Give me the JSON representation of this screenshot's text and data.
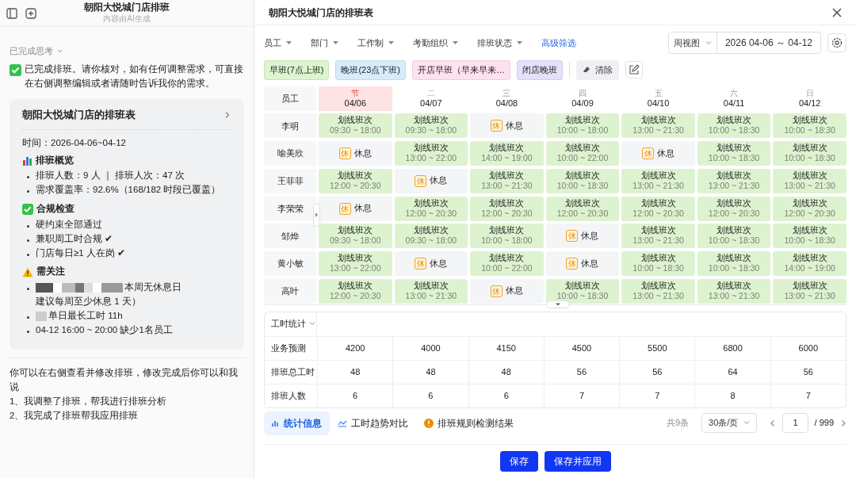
{
  "chat": {
    "title": "朝阳大悦城门店排班",
    "subtitle": "内容由AI生成",
    "thinking": "已完成思考",
    "message": "已完成排班。请你核对，如有任何调整需求，可直接在右侧调整编辑或者请随时告诉我你的需求。",
    "card": {
      "title": "朝阳大悦城门店的排班表",
      "time": "时间：2026-04-06~04-12",
      "sections": [
        {
          "kind": "chart",
          "title": "排班概览",
          "items": [
            {
              "text": "排班人数：9 人 ｜ 排班人次：47 次",
              "redacted": false
            },
            {
              "text": "需求覆盖率：92.6%（168/182 时段已覆盖）",
              "redacted": false
            }
          ]
        },
        {
          "kind": "check",
          "title": "合规检查",
          "items": [
            {
              "text": "硬约束全部通过",
              "redacted": false
            },
            {
              "text": "兼职周工时合规 ✔",
              "redacted": false
            },
            {
              "text": "门店每日≥1 人在岗 ✔",
              "redacted": false
            }
          ]
        },
        {
          "kind": "warning",
          "title": "需关注",
          "items": [
            {
              "text": "本周无休息日",
              "note": "建议每周至少休息 1 天）",
              "redacted": true
            },
            {
              "text": "单日最长工时 11h",
              "redacted": true
            },
            {
              "text": "04-12 16:00 ~ 20:00 缺少1名员工",
              "redacted": false
            }
          ]
        }
      ]
    },
    "footer": [
      "你可以在右侧查看并修改排班，修改完成后你可以和我说",
      "1、我调整了排班，帮我进行排班分析",
      "2、我完成了排班帮我应用排班"
    ]
  },
  "panel": {
    "title": "朝阳大悦城门店的排班表",
    "filters": [
      "员工",
      "部门",
      "工作制",
      "考勤组织",
      "排班状态"
    ],
    "advanced_filter": "高级筛选",
    "view": "周视图",
    "date_range": "2026 04-06 ～ 04-12",
    "tags": [
      {
        "label": "早班(7点上班)",
        "color": "#dcf5cf"
      },
      {
        "label": "晚班(23点下班)",
        "color": "#d6ecfb"
      },
      {
        "label": "开店早班（早来早来…",
        "color": "#fde1f0"
      },
      {
        "label": "闭店晚班",
        "color": "#e4e0fb"
      }
    ],
    "clear_button": "清除",
    "schedule": {
      "corner": "员工",
      "days": [
        {
          "weekday": "节",
          "date": "04/06",
          "holiday": true
        },
        {
          "weekday": "二",
          "date": "04/07",
          "holiday": false
        },
        {
          "weekday": "三",
          "date": "04/08",
          "holiday": false
        },
        {
          "weekday": "四",
          "date": "04/09",
          "holiday": false
        },
        {
          "weekday": "五",
          "date": "04/10",
          "holiday": false
        },
        {
          "weekday": "六",
          "date": "04/11",
          "holiday": false
        },
        {
          "weekday": "日",
          "date": "04/12",
          "holiday": false
        }
      ],
      "rows": [
        {
          "name": "李明",
          "cells": [
            {
              "kind": "shift",
              "label": "划线班次",
              "time": "09:30 ~ 18:00"
            },
            {
              "kind": "shift",
              "label": "划线班次",
              "time": "09:30 ~ 18:00"
            },
            {
              "kind": "rest",
              "badge": "休",
              "label": "休息"
            },
            {
              "kind": "shift",
              "label": "划线班次",
              "time": "10:00 ~ 18:00"
            },
            {
              "kind": "shift",
              "label": "划线班次",
              "time": "13:00 ~ 21:30"
            },
            {
              "kind": "shift",
              "label": "划线班次",
              "time": "10:00 ~ 18:30"
            },
            {
              "kind": "shift",
              "label": "划线班次",
              "time": "10:00 ~ 18:30"
            }
          ]
        },
        {
          "name": "喻美欣",
          "cells": [
            {
              "kind": "rest",
              "badge": "休",
              "label": "休息"
            },
            {
              "kind": "shift",
              "label": "划线班次",
              "time": "13:00 ~ 22:00"
            },
            {
              "kind": "shift",
              "label": "划线班次",
              "time": "14:00 ~ 19:00"
            },
            {
              "kind": "shift",
              "label": "划线班次",
              "time": "10:00 ~ 22:00"
            },
            {
              "kind": "rest",
              "badge": "休",
              "label": "休息"
            },
            {
              "kind": "shift",
              "label": "划线班次",
              "time": "10:00 ~ 18:30"
            },
            {
              "kind": "shift",
              "label": "划线班次",
              "time": "10:00 ~ 18:30"
            }
          ]
        },
        {
          "name": "王菲菲",
          "cells": [
            {
              "kind": "shift",
              "label": "划线班次",
              "time": "12:00 ~ 20:30"
            },
            {
              "kind": "rest",
              "badge": "休",
              "label": "休息"
            },
            {
              "kind": "shift",
              "label": "划线班次",
              "time": "13:00 ~ 21:30"
            },
            {
              "kind": "shift",
              "label": "划线班次",
              "time": "10:00 ~ 18:30"
            },
            {
              "kind": "shift",
              "label": "划线班次",
              "time": "13:00 ~ 21:30"
            },
            {
              "kind": "shift",
              "label": "划线班次",
              "time": "13:00 ~ 21:30"
            },
            {
              "kind": "shift",
              "label": "划线班次",
              "time": "13:00 ~ 21:30"
            }
          ]
        },
        {
          "name": "李荣荣",
          "cells": [
            {
              "kind": "rest",
              "badge": "休",
              "label": "休息"
            },
            {
              "kind": "shift",
              "label": "划线班次",
              "time": "12:00 ~ 20:30"
            },
            {
              "kind": "shift",
              "label": "划线班次",
              "time": "12:00 ~ 20:30"
            },
            {
              "kind": "shift",
              "label": "划线班次",
              "time": "12:00 ~ 20:30"
            },
            {
              "kind": "shift",
              "label": "划线班次",
              "time": "12:00 ~ 20:30"
            },
            {
              "kind": "shift",
              "label": "划线班次",
              "time": "12:00 ~ 20:30"
            },
            {
              "kind": "shift",
              "label": "划线班次",
              "time": "12:00 ~ 20:30"
            }
          ]
        },
        {
          "name": "邹烨",
          "cells": [
            {
              "kind": "shift",
              "label": "划线班次",
              "time": "09:30 ~ 18:00"
            },
            {
              "kind": "shift",
              "label": "划线班次",
              "time": "09:30 ~ 18:00"
            },
            {
              "kind": "shift",
              "label": "划线班次",
              "time": "10:00 ~ 18:00"
            },
            {
              "kind": "rest",
              "badge": "休",
              "label": "休息"
            },
            {
              "kind": "shift",
              "label": "划线班次",
              "time": "13:00 ~ 21:30"
            },
            {
              "kind": "shift",
              "label": "划线班次",
              "time": "10:00 ~ 18:30"
            },
            {
              "kind": "shift",
              "label": "划线班次",
              "time": "10:00 ~ 18:30"
            }
          ]
        },
        {
          "name": "黄小敏",
          "cells": [
            {
              "kind": "shift",
              "label": "划线班次",
              "time": "13:00 ~ 22:00"
            },
            {
              "kind": "rest",
              "badge": "休",
              "label": "休息"
            },
            {
              "kind": "shift",
              "label": "划线班次",
              "time": "10:00 ~ 22:00"
            },
            {
              "kind": "rest",
              "badge": "休",
              "label": "休息"
            },
            {
              "kind": "shift",
              "label": "划线班次",
              "time": "10:00 ~ 18:30"
            },
            {
              "kind": "shift",
              "label": "划线班次",
              "time": "10:00 ~ 18:30"
            },
            {
              "kind": "shift",
              "label": "划线班次",
              "time": "14:00 ~ 19:00"
            }
          ]
        },
        {
          "name": "高叶",
          "cells": [
            {
              "kind": "shift",
              "label": "划线班次",
              "time": "12:00 ~ 20:30"
            },
            {
              "kind": "shift",
              "label": "划线班次",
              "time": "13:00 ~ 21:30"
            },
            {
              "kind": "rest",
              "badge": "休",
              "label": "休息"
            },
            {
              "kind": "shift",
              "label": "划线班次",
              "time": "10:00 ~ 18:30"
            },
            {
              "kind": "shift",
              "label": "划线班次",
              "time": "13:00 ~ 21:30"
            },
            {
              "kind": "shift",
              "label": "划线班次",
              "time": "13:00 ~ 21:30"
            },
            {
              "kind": "shift",
              "label": "划线班次",
              "time": "13:00 ~ 21:30"
            }
          ]
        }
      ]
    },
    "stats": {
      "selector": "工时统计",
      "rows": [
        {
          "label": "业务预测",
          "values": [
            "4200",
            "4000",
            "4150",
            "4500",
            "5500",
            "6800",
            "6000"
          ]
        },
        {
          "label": "排班总工时",
          "values": [
            "48",
            "48",
            "48",
            "56",
            "56",
            "64",
            "56"
          ]
        },
        {
          "label": "排班人数",
          "values": [
            "6",
            "6",
            "6",
            "7",
            "7",
            "8",
            "7"
          ]
        }
      ]
    },
    "bottom_tabs": [
      {
        "kind": "stats",
        "label": "统计信息",
        "selected": true
      },
      {
        "kind": "trend",
        "label": "工时趋势对比",
        "selected": false
      },
      {
        "kind": "alert",
        "label": "排班规则检测结果",
        "selected": false
      }
    ],
    "pagination": {
      "total": "共9条",
      "page_size": "30条/页",
      "page": "1",
      "pages": "/ 999"
    },
    "buttons": [
      "保存",
      "保存并应用"
    ]
  }
}
